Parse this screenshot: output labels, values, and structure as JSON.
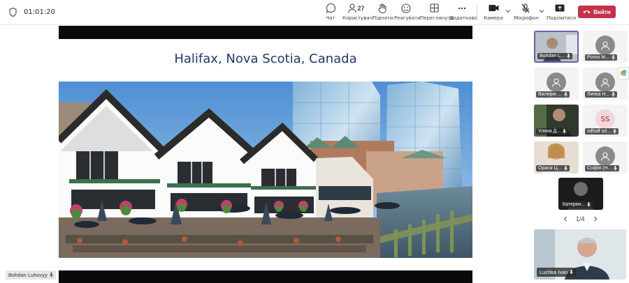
{
  "meeting": {
    "timer": "01:01:20"
  },
  "toolbar": {
    "chat": "Чат",
    "people": "Користувачі",
    "people_count": "27",
    "raise": "Підняти",
    "react": "Реагувати",
    "view": "Переглянути",
    "more": "Додатково",
    "camera": "Камера",
    "mic": "Мікрофон",
    "share": "Поділитися",
    "leave": "Вийти"
  },
  "slide": {
    "title": "Halifax, Nova Scotia, Canada"
  },
  "presenter": {
    "name": "Bohdan Luhovyy"
  },
  "participants": [
    {
      "name": "Bohdan L..."
    },
    {
      "name": "Рілло М..."
    },
    {
      "name": "Валерія ..."
    },
    {
      "name": "Липка Н..."
    },
    {
      "name": "Уляна Д..."
    },
    {
      "name": "sdfsdf sd...",
      "initials": "SS"
    },
    {
      "name": "Орися Ц..."
    },
    {
      "name": "Софія (Н..."
    },
    {
      "name": "Катерин..."
    }
  ],
  "pagination": {
    "label": "1/4"
  },
  "featured": {
    "name": "Luchka Ivan"
  },
  "colors": {
    "leave": "#c4314b",
    "active_border": "#6264a7",
    "title": "#1f3864"
  }
}
